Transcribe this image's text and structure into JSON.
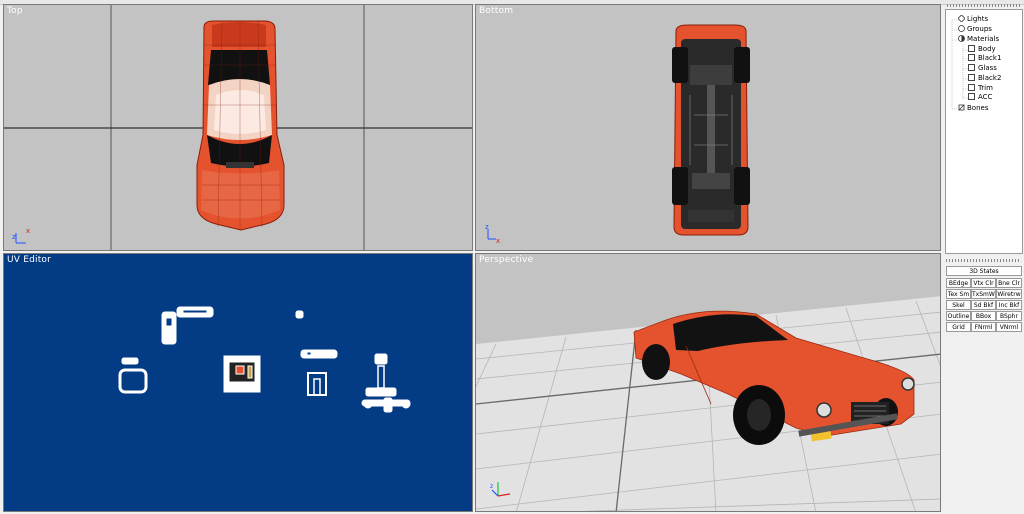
{
  "viewports": {
    "top": {
      "title": "Top"
    },
    "bottom": {
      "title": "Bottom"
    },
    "uv": {
      "title": "UV Editor"
    },
    "perspective": {
      "title": "Perspective"
    }
  },
  "scene_tree": {
    "items": [
      {
        "label": "Lights",
        "icon": "light-icon"
      },
      {
        "label": "Groups",
        "icon": "groups-icon"
      },
      {
        "label": "Materials",
        "icon": "materials-icon"
      },
      {
        "label": "Body",
        "icon": "material-icon"
      },
      {
        "label": "Black1",
        "icon": "material-icon"
      },
      {
        "label": "Glass",
        "icon": "material-icon"
      },
      {
        "label": "Black2",
        "icon": "material-icon"
      },
      {
        "label": "Trim",
        "icon": "material-icon"
      },
      {
        "label": "ACC",
        "icon": "material-icon"
      },
      {
        "label": "Bones",
        "icon": "bones-icon"
      }
    ]
  },
  "states_panel": {
    "title": "3D States",
    "buttons": [
      "BEdge",
      "Vtx Clr",
      "Bne Clr",
      "Tex Sm",
      "TxSmWr",
      "Wiretrw",
      "Skel",
      "Sd Bkf",
      "Inc Bkf",
      "Outline",
      "BBox",
      "BSphr",
      "Grid",
      "FNrml",
      "VNrml"
    ]
  },
  "colors": {
    "viewport_gray": "#c3c3c3",
    "uv_blue": "#033c85",
    "car_orange": "#e5532e",
    "car_dark": "#101010"
  }
}
